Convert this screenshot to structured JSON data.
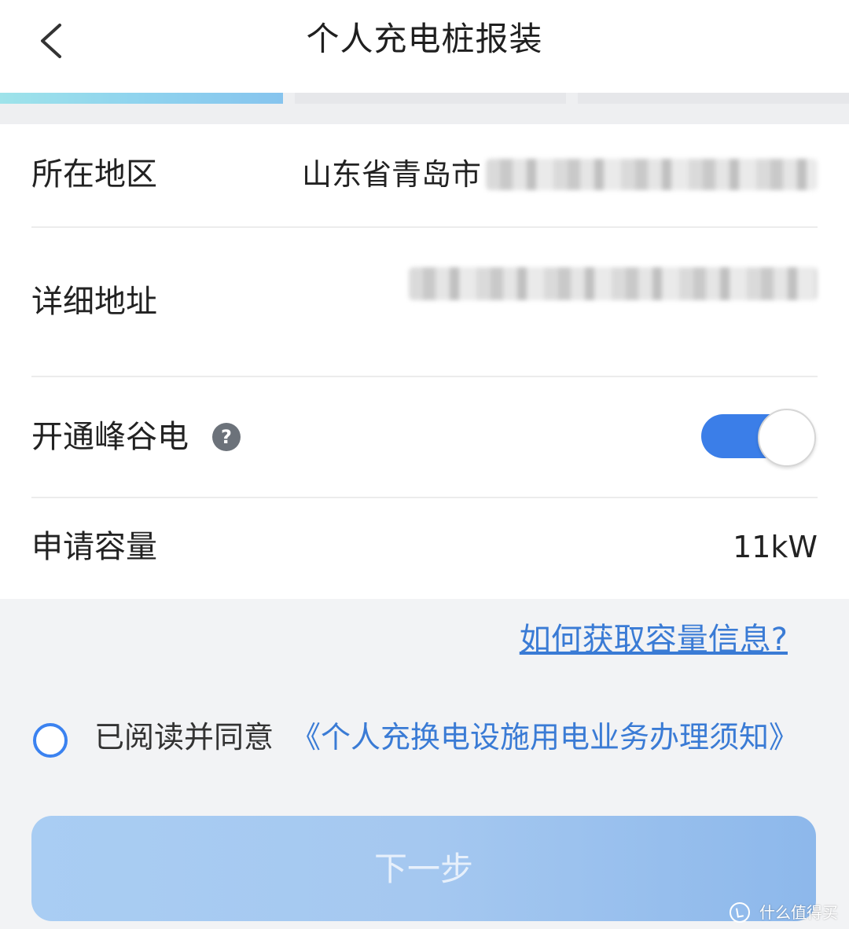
{
  "header": {
    "title": "个人充电桩报装",
    "back_icon": "chevron-left-icon"
  },
  "steps": {
    "count": 3,
    "current": 1,
    "active_gradient": [
      "#9ee3ea",
      "#86c4ee"
    ]
  },
  "form": {
    "region": {
      "label": "所在地区",
      "value_visible": "山东省青岛市"
    },
    "address": {
      "label": "详细地址"
    },
    "peak_valley": {
      "label": "开通峰谷电",
      "help_icon": "question-icon",
      "help_symbol": "?",
      "enabled": true
    },
    "capacity": {
      "label": "申请容量",
      "value": "11kW"
    }
  },
  "help_link": "如何获取容量信息?",
  "agreement": {
    "checked": false,
    "text": "已阅读并同意",
    "link": "《个人充换电设施用电业务办理须知》"
  },
  "next_button": {
    "label": "下一步"
  },
  "watermark": {
    "text": "什么值得买"
  },
  "colors": {
    "accent": "#3b7ee8",
    "link": "#3a7bd5",
    "button_disabled": "#a5c8f0",
    "background": "#f2f3f5"
  }
}
